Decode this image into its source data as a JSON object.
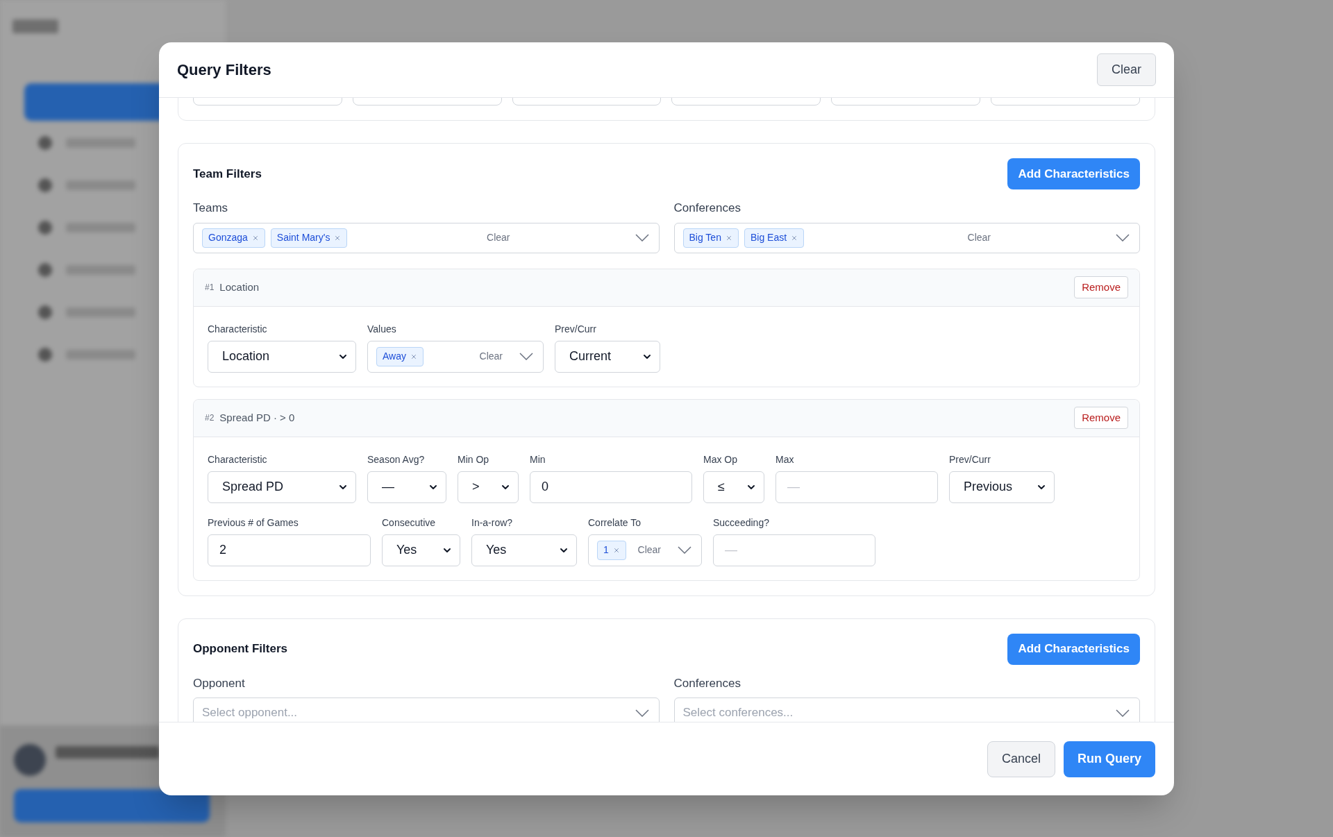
{
  "dialog": {
    "title": "Query Filters",
    "clear_button": "Clear"
  },
  "team_filters": {
    "title": "Team Filters",
    "add_button": "Add Characteristics",
    "selectors": [
      {
        "label": "Teams",
        "tags": [
          "Gonzaga",
          "Saint Mary's"
        ],
        "clear": "Clear"
      },
      {
        "label": "Conferences",
        "tags": [
          "Big Ten",
          "Big East"
        ],
        "clear": "Clear"
      }
    ],
    "characteristics": [
      {
        "index": "#1",
        "summary": "Location",
        "remove": "Remove",
        "rows": [
          [
            {
              "kind": "select",
              "label": "Characteristic",
              "value": "Location"
            },
            {
              "kind": "multi",
              "label": "Values",
              "tags": [
                "Away"
              ],
              "clear": "Clear"
            },
            {
              "kind": "select",
              "label": "Prev/Curr",
              "value": "Current"
            }
          ]
        ]
      },
      {
        "index": "#2",
        "summary": "Spread PD · > 0",
        "remove": "Remove",
        "rows": [
          [
            {
              "kind": "select",
              "label": "Characteristic",
              "value": "Spread PD"
            },
            {
              "kind": "select",
              "label": "Season Avg?",
              "value": "—"
            },
            {
              "kind": "select",
              "label": "Min Op",
              "value": ">"
            },
            {
              "kind": "input",
              "label": "Min",
              "value": "0"
            },
            {
              "kind": "select",
              "label": "Max Op",
              "value": "≤"
            },
            {
              "kind": "input",
              "label": "Max",
              "placeholder": "—"
            },
            {
              "kind": "select",
              "label": "Prev/Curr",
              "value": "Previous"
            }
          ],
          [
            {
              "kind": "input",
              "label": "Previous # of Games",
              "value": "2"
            },
            {
              "kind": "select",
              "label": "Consecutive",
              "value": "Yes"
            },
            {
              "kind": "select",
              "label": "In-a-row?",
              "value": "Yes"
            },
            {
              "kind": "multi",
              "label": "Correlate To",
              "tags": [
                "1"
              ],
              "clear": "Clear"
            },
            {
              "kind": "input",
              "label": "Succeeding?",
              "placeholder": "—"
            }
          ]
        ]
      }
    ]
  },
  "opponent_filters": {
    "title": "Opponent Filters",
    "add_button": "Add Characteristics",
    "selectors": [
      {
        "label": "Opponent",
        "placeholder": "Select opponent..."
      },
      {
        "label": "Conferences",
        "placeholder": "Select conferences..."
      }
    ]
  },
  "footer": {
    "cancel": "Cancel",
    "run": "Run Query"
  }
}
